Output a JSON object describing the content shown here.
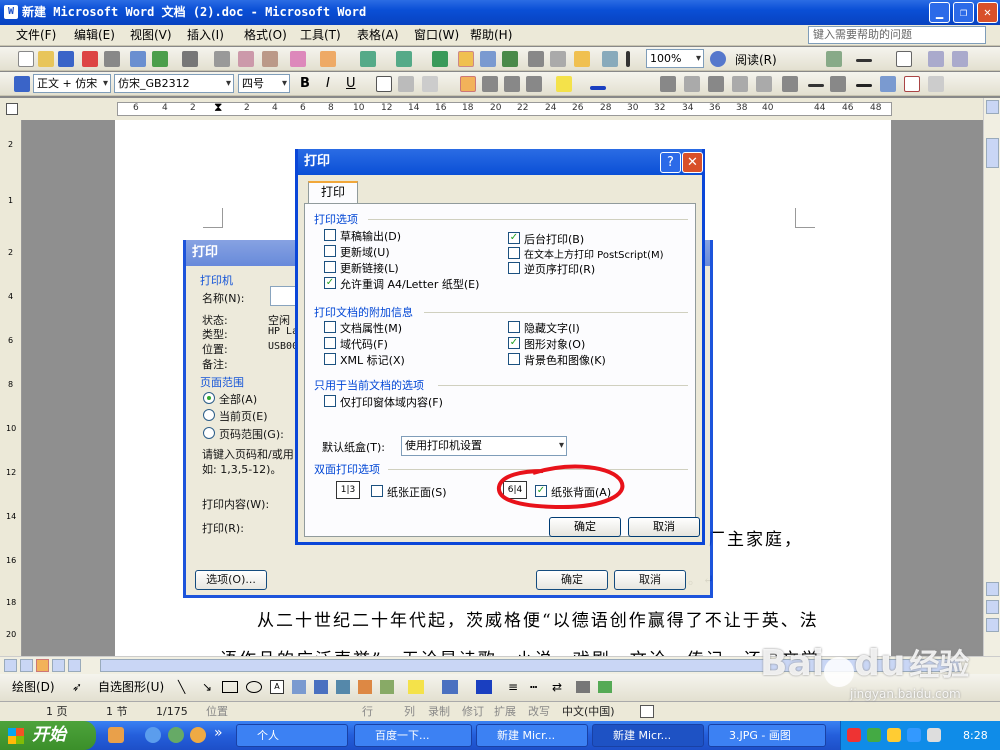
{
  "window": {
    "title": "新建 Microsoft Word 文档 (2).doc - Microsoft Word"
  },
  "menu": {
    "items": [
      "文件(F)",
      "编辑(E)",
      "视图(V)",
      "插入(I)",
      "格式(O)",
      "工具(T)",
      "表格(A)",
      "窗口(W)",
      "帮助(H)"
    ],
    "help_placeholder": "键入需要帮助的问题"
  },
  "toolbar": {
    "zoom": "100%",
    "read_label": "阅读(R)",
    "style": "正文 + 仿宋",
    "font": "仿宋_GB2312",
    "size": "四号",
    "bold": "B",
    "italic": "I",
    "underline": "U"
  },
  "ruler": {
    "ticks": [
      "6",
      "4",
      "2",
      "2",
      "4",
      "6",
      "8",
      "10",
      "12",
      "14",
      "16",
      "18",
      "20",
      "22",
      "24",
      "26",
      "28",
      "30",
      "32",
      "34",
      "36",
      "38",
      "40",
      "44",
      "46",
      "48"
    ],
    "vticks": [
      "2",
      "1",
      "2",
      "4",
      "6",
      "8",
      "10",
      "12",
      "14",
      "16",
      "18",
      "20"
    ]
  },
  "document": {
    "line1_tail": "厂主家庭，",
    "line2_tail": "。↵",
    "line3": "从二十世纪二十年代起，茨威格便“以德语创作赢得了不让于英、法",
    "line4": "语作品的广泛声誉”，无论是诗歌、小说、戏剧、文论、传记，还是文学"
  },
  "back_dialog": {
    "title": "打印",
    "printer_section": "打印机",
    "name_label": "名称(N):",
    "status_label": "状态:",
    "status_value": "空闲",
    "type_label": "类型:",
    "type_value": "HP La",
    "where_label": "位置:",
    "where_value": "USB00",
    "comment_label": "备注:",
    "range_section": "页面范围",
    "all": "全部(A)",
    "current": "当前页(E)",
    "pages": "页码范围(G):",
    "hint1": "请键入页码和/或用",
    "hint2": "如: 1,3,5-12)。",
    "print_what": "打印内容(W):",
    "print": "打印(R):",
    "options": "选项(O)...",
    "ok": "确定",
    "cancel": "取消"
  },
  "dialog": {
    "title": "打印",
    "help": "?",
    "tab": "打印",
    "print_options": "打印选项",
    "draft": "草稿输出(D)",
    "update_fields": "更新域(U)",
    "update_links": "更新链接(L)",
    "allow_a4": "允许重调 A4/Letter 纸型(E)",
    "background": "后台打印(B)",
    "postscript": "在文本上方打印 PostScript(M)",
    "reverse": "逆页序打印(R)",
    "include_section": "打印文档的附加信息",
    "doc_props": "文档属性(M)",
    "field_codes": "域代码(F)",
    "xml_tags": "XML 标记(X)",
    "hidden_text": "隐藏文字(I)",
    "drawing_objects": "图形对象(O)",
    "bg_colors": "背景色和图像(K)",
    "current_doc_section": "只用于当前文档的选项",
    "form_data": "仅打印窗体域内容(F)",
    "tray_label": "默认纸盒(T):",
    "tray_value": "使用打印机设置",
    "duplex_section": "双面打印选项",
    "front": "纸张正面(S)",
    "back": "纸张背面(A)",
    "ok": "确定",
    "cancel": "取消",
    "checked": {
      "draft": false,
      "update_fields": false,
      "update_links": false,
      "allow_a4": true,
      "background": true,
      "postscript": false,
      "reverse": false,
      "doc_props": false,
      "field_codes": false,
      "xml_tags": false,
      "hidden_text": false,
      "drawing_objects": true,
      "bg_colors": false,
      "form_data": false,
      "front": false,
      "back": true
    }
  },
  "drawing": {
    "draw": "绘图(D)",
    "autoshapes": "自选图形(U)"
  },
  "status": {
    "page": "1 页",
    "section": "1 节",
    "pos": "1/175",
    "at": "位置",
    "ln": "行",
    "col": "列",
    "rec": "录制",
    "trk": "修订",
    "ext": "扩展",
    "ovr": "改写",
    "lang": "中文(中国)"
  },
  "taskbar": {
    "start": "开始",
    "tasks": [
      "个人",
      "百度一下...",
      "新建 Micr...",
      "新建 Micr...",
      "3.JPG - 画图"
    ],
    "clock": "8:28"
  },
  "watermark": {
    "brand": "Bai",
    "brand2": "du",
    "cn": "经验",
    "url": "jingyan.baidu.com"
  },
  "colors": {
    "accent": "#0a4fd6",
    "annotation": "#e8121a",
    "check": "#21a121"
  }
}
